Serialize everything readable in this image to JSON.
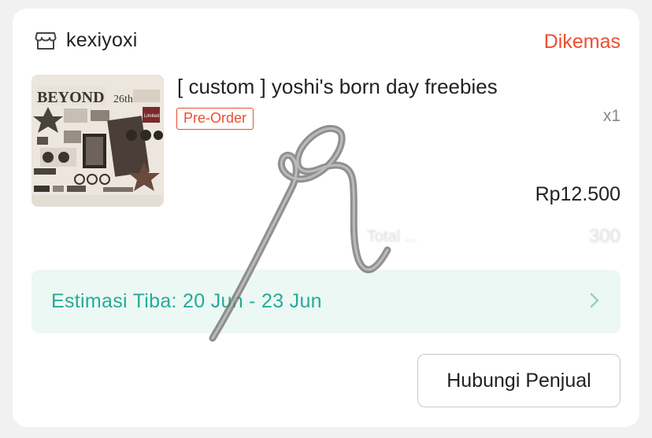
{
  "shop": {
    "icon": "store-icon",
    "name": "kexiyoxi"
  },
  "order": {
    "status": "Dikemas",
    "status_color": "#ee4d2d"
  },
  "product": {
    "thumbnail_text": "BEYOND",
    "thumbnail_sub": "26th",
    "title": "[ custom ] yoshi's born day freebies",
    "badge": "Pre-Order",
    "quantity": "x1",
    "price": "Rp12.500"
  },
  "total": {
    "label": "Total ...",
    "value": "300"
  },
  "delivery": {
    "eta": "Estimasi Tiba: 20 Jun - 23 Jun",
    "eta_color": "#26aa99",
    "chevron_icon": "chevron-right-icon"
  },
  "actions": {
    "contact_seller": "Hubungi Penjual"
  }
}
